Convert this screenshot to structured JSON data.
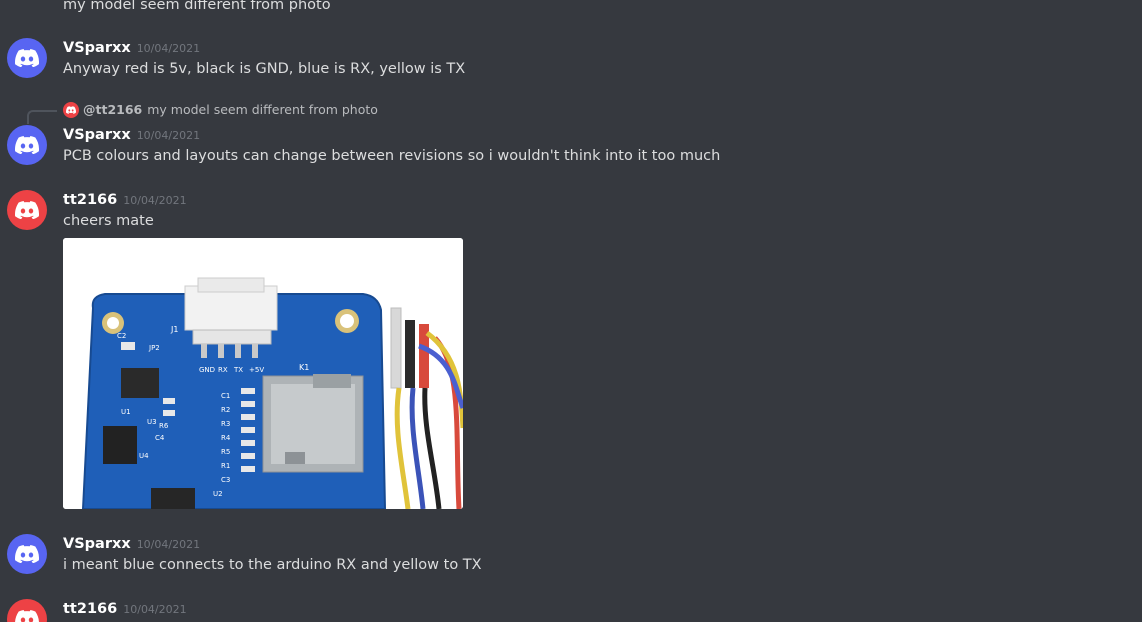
{
  "top_partial": {
    "text": "my model seem different  from photo"
  },
  "messages": [
    {
      "author": "VSparxx",
      "timestamp": "10/04/2021",
      "text": "Anyway red is 5v, black is GND, blue is RX, yellow is TX",
      "avatar_color": "#5865f2"
    },
    {
      "reply": {
        "author": "@tt2166",
        "text": "my model seem different  from photo"
      },
      "author": "VSparxx",
      "timestamp": "10/04/2021",
      "text": "PCB colours and layouts can change between revisions so i wouldn't think into it too much",
      "avatar_color": "#5865f2"
    },
    {
      "author": "tt2166",
      "timestamp": "10/04/2021",
      "text": "cheers mate",
      "avatar_color": "#ed4245",
      "attachment": {
        "labels": {
          "j1": "J1",
          "k1": "K1",
          "u1": "U1",
          "u2": "U2",
          "u3": "U3",
          "u4": "U4",
          "c2": "C2",
          "jp2": "JP2",
          "r1": "R1",
          "r2": "R2",
          "r3": "R3",
          "r4": "R4",
          "r5": "R5",
          "r6": "R6",
          "c1": "C1",
          "c3": "C3",
          "c4": "C4",
          "pin_gnd": "GND",
          "pin_rx": "RX",
          "pin_tx": "TX",
          "pin_5v": "+5V"
        }
      }
    },
    {
      "author": "VSparxx",
      "timestamp": "10/04/2021",
      "text": "i meant blue connects to the arduino RX and yellow to TX",
      "avatar_color": "#5865f2"
    },
    {
      "author": "tt2166",
      "timestamp": "10/04/2021",
      "avatar_color": "#ed4245"
    }
  ]
}
